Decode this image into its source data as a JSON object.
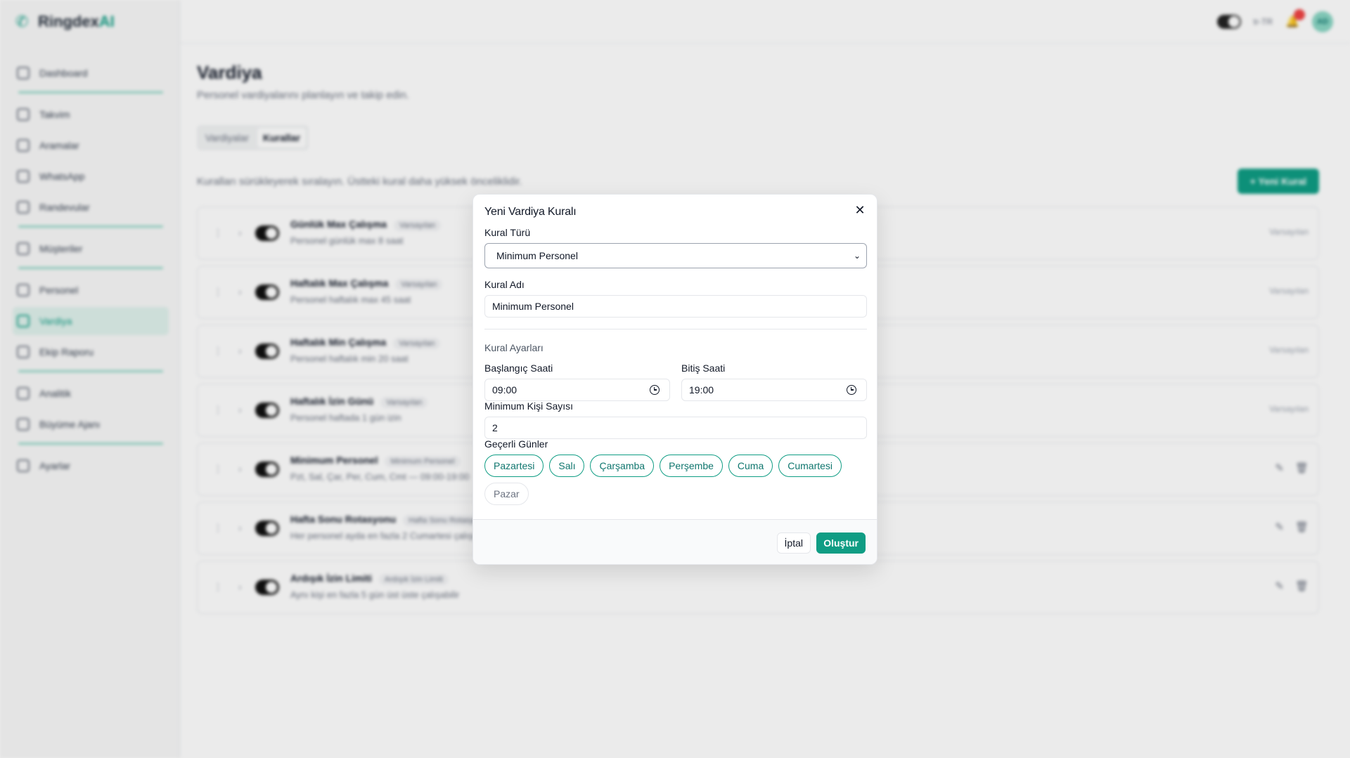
{
  "app": {
    "brand": "Ringdex",
    "brand_suffix": "AI",
    "lang": "tr-TR",
    "notif_count": "",
    "avatar_initials": "AD"
  },
  "sidebar": {
    "items": [
      {
        "label": "Dashboard",
        "icon": "grid-icon",
        "active": false
      },
      {
        "label": "Takvim",
        "icon": "calendar-icon",
        "active": false
      },
      {
        "label": "Aramalar",
        "icon": "phone-icon",
        "active": false
      },
      {
        "label": "WhatsApp",
        "icon": "chat-icon",
        "active": false
      },
      {
        "label": "Randevular",
        "icon": "clipboard-icon",
        "active": false
      },
      {
        "label": "Müşteriler",
        "icon": "users-icon",
        "active": false
      },
      {
        "label": "Personel",
        "icon": "team-icon",
        "active": false
      },
      {
        "label": "Vardiya",
        "icon": "shift-icon",
        "active": true
      },
      {
        "label": "Ekip Raporu",
        "icon": "trend-icon",
        "active": false
      },
      {
        "label": "Analitik",
        "icon": "chart-icon",
        "active": false
      },
      {
        "label": "Büyüme Ajanı",
        "icon": "rocket-icon",
        "active": false
      },
      {
        "label": "Ayarlar",
        "icon": "gear-icon",
        "active": false
      }
    ]
  },
  "page": {
    "title": "Vardiya",
    "subtitle": "Personel vardiyalarını planlayın ve takip edin.",
    "tabs": [
      "Vardiyalar",
      "Kurallar"
    ],
    "rules_desc": "Kuralları sürükleyerek sıralayın. Üstteki kural daha yüksek önceliklidir.",
    "new_rule_label": "Yeni Kural",
    "rules": [
      {
        "name": "Günlük Max Çalışma",
        "badge": "Varsayılan",
        "desc": "Personel günlük max 8 saat",
        "status": "Varsayılan"
      },
      {
        "name": "Haftalık Max Çalışma",
        "badge": "Varsayılan",
        "desc": "Personel haftalık max 45 saat",
        "status": "Varsayılan"
      },
      {
        "name": "Haftalık Min Çalışma",
        "badge": "Varsayılan",
        "desc": "Personel haftalık min 20 saat",
        "status": "Varsayılan"
      },
      {
        "name": "Haftalık İzin Günü",
        "badge": "Varsayılan",
        "desc": "Personel haftada 1 gün izin",
        "status": "Varsayılan"
      },
      {
        "name": "Minimum Personel",
        "badge": "Minimum Personel",
        "desc": "Pzt, Sal, Çar, Per, Cum, Cmt — 09:00-19:00",
        "status": ""
      },
      {
        "name": "Hafta Sonu Rotasyonu",
        "badge": "Hafta Sonu Rotasyonu",
        "desc": "Her personel ayda en fazla 2 Cumartesi çalışır",
        "status": ""
      },
      {
        "name": "Ardışık İzin Limiti",
        "badge": "Ardışık İzin Limiti",
        "desc": "Aynı kişi en fazla 5 gün üst üste çalışabilir",
        "status": ""
      }
    ]
  },
  "modal": {
    "title": "Yeni Vardiya Kuralı",
    "rule_type_label": "Kural Türü",
    "rule_type_value": "Minimum Personel",
    "rule_name_label": "Kural Adı",
    "rule_name_value": "Minimum Personel",
    "settings_label": "Kural Ayarları",
    "start_label": "Başlangıç Saati",
    "start_value": "09:00",
    "end_label": "Bitiş Saati",
    "end_value": "19:00",
    "min_people_label": "Minimum Kişi Sayısı",
    "min_people_value": "2",
    "days_label": "Geçerli Günler",
    "days": [
      {
        "label": "Pazartesi",
        "selected": true
      },
      {
        "label": "Salı",
        "selected": true
      },
      {
        "label": "Çarşamba",
        "selected": true
      },
      {
        "label": "Perşembe",
        "selected": true
      },
      {
        "label": "Cuma",
        "selected": true
      },
      {
        "label": "Cumartesi",
        "selected": true
      },
      {
        "label": "Pazar",
        "selected": false
      }
    ],
    "cancel_label": "İptal",
    "create_label": "Oluştur"
  },
  "colors": {
    "accent": "#0f9d84",
    "accent_light": "#dff1ec"
  }
}
